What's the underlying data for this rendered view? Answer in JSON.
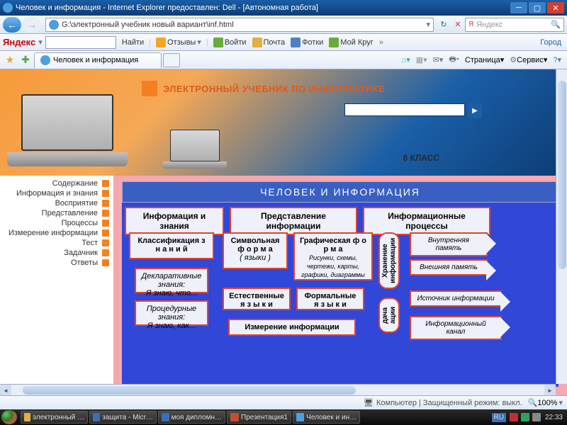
{
  "titlebar": {
    "title": "Человек и информация - Internet Explorer предоставлен: Dell - [Автономная работа]"
  },
  "nav": {
    "url": "G:\\электронный учебник новый вариант\\inf.html",
    "search_placeholder": "Яндекс"
  },
  "yandex": {
    "logo": "Яндекс",
    "find": "Найти",
    "reviews": "Отзывы",
    "login": "Войти",
    "mail": "Почта",
    "photos": "Фотки",
    "circle": "Мой Круг",
    "city": "Город"
  },
  "tab": {
    "title": "Человек и информация"
  },
  "tabbar_right": {
    "page": "Страница",
    "service": "Сервис"
  },
  "banner": {
    "title": "ЭЛЕКТРОННЫЙ УЧЕБНИК ПО ИНФОРМАТИКЕ",
    "grade": "8 КЛАСС"
  },
  "sidebar": {
    "items": [
      "Содержание",
      "Информация и знания",
      "Восприятие",
      "Представление",
      "Процессы",
      "Измерение информации",
      "Тест",
      "Задачник",
      "Ответы"
    ]
  },
  "diagram": {
    "title": "ЧЕЛОВЕК  И  ИНФОРМАЦИЯ",
    "top1": "Информация  и  знания",
    "top2": "Представление  информации",
    "top3": "Информационные  процессы",
    "classif": "Классификация  з н а н и й",
    "symbolic1": "Символьная  ф о р м а",
    "symbolic2": "( языки )",
    "graphic1": "Графическая  ф о р м а",
    "graphic2": "Рисунки, схемы, чертежи, карты, графики, диаграммы",
    "decl1": "Декларативные знания:",
    "decl2": "Я знаю, что...",
    "proc1": "Процедурные знания:",
    "proc2": "Я знаю, как...",
    "nat": "Естественные  я з ы к и",
    "formal": "Формальные  я з ы к и",
    "measure": "Измерение  информации",
    "storage": "Хранение информации",
    "transfer": "дача ации",
    "internal": "Внутренняя память",
    "external": "Внешняя память",
    "source": "Источник информации",
    "channel": "Информационный канал"
  },
  "status": {
    "mid": "Компьютер | Защищенный режим: выкл.",
    "zoom": "100%"
  },
  "taskbar": {
    "items": [
      "электронный …",
      "защита - Micr…",
      "моя дипломн…",
      "Презентация1",
      "Человек и ин…"
    ],
    "lang": "RU",
    "clock": "22:33"
  }
}
